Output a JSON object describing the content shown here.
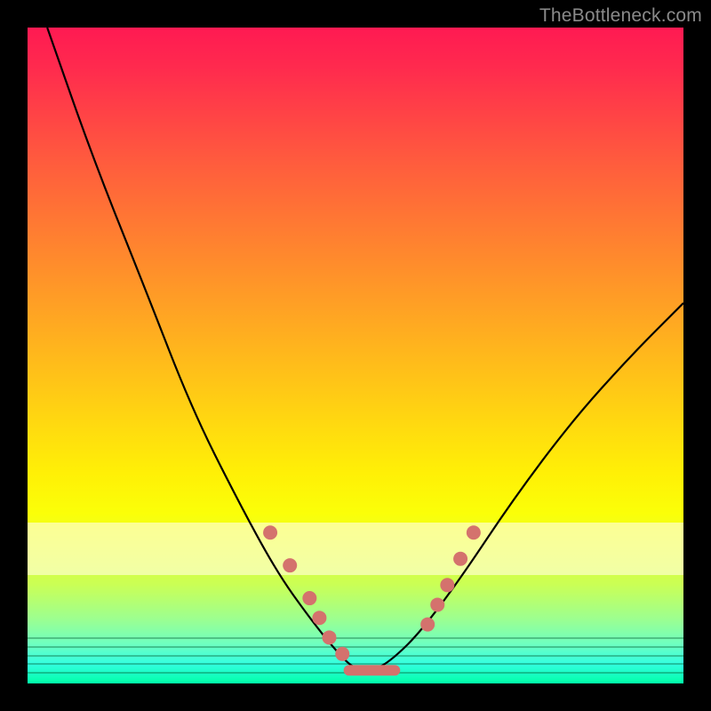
{
  "watermark": "TheBottleneck.com",
  "chart_data": {
    "type": "line",
    "title": "",
    "xlabel": "",
    "ylabel": "",
    "xlim": [
      0,
      100
    ],
    "ylim": [
      0,
      100
    ],
    "series": [
      {
        "name": "bottleneck-curve",
        "x": [
          3,
          10,
          18,
          25,
          32,
          38,
          43,
          47,
          50,
          53,
          56,
          60,
          66,
          74,
          83,
          92,
          100
        ],
        "values": [
          100,
          80,
          60,
          42,
          28,
          17,
          10,
          5,
          2,
          2,
          4,
          8,
          16,
          28,
          40,
          50,
          58
        ]
      }
    ],
    "markers": {
      "name": "highlight-dots",
      "color": "#d4726d",
      "points": [
        {
          "x": 37,
          "y": 23
        },
        {
          "x": 40,
          "y": 18
        },
        {
          "x": 43,
          "y": 13
        },
        {
          "x": 44.5,
          "y": 10
        },
        {
          "x": 46,
          "y": 7
        },
        {
          "x": 48,
          "y": 4.5
        },
        {
          "x": 61,
          "y": 9
        },
        {
          "x": 62.5,
          "y": 12
        },
        {
          "x": 64,
          "y": 15
        },
        {
          "x": 66,
          "y": 19
        },
        {
          "x": 68,
          "y": 23
        }
      ]
    },
    "flat_segment": {
      "x0": 49,
      "x1": 56,
      "y": 2
    },
    "highlight_band": {
      "y0": 16,
      "y1": 24
    },
    "gradient_stops": [
      {
        "pos": 0,
        "color": "#ff1a52"
      },
      {
        "pos": 50,
        "color": "#ffb21e"
      },
      {
        "pos": 75,
        "color": "#fbff08"
      },
      {
        "pos": 100,
        "color": "#00ffa8"
      }
    ]
  }
}
